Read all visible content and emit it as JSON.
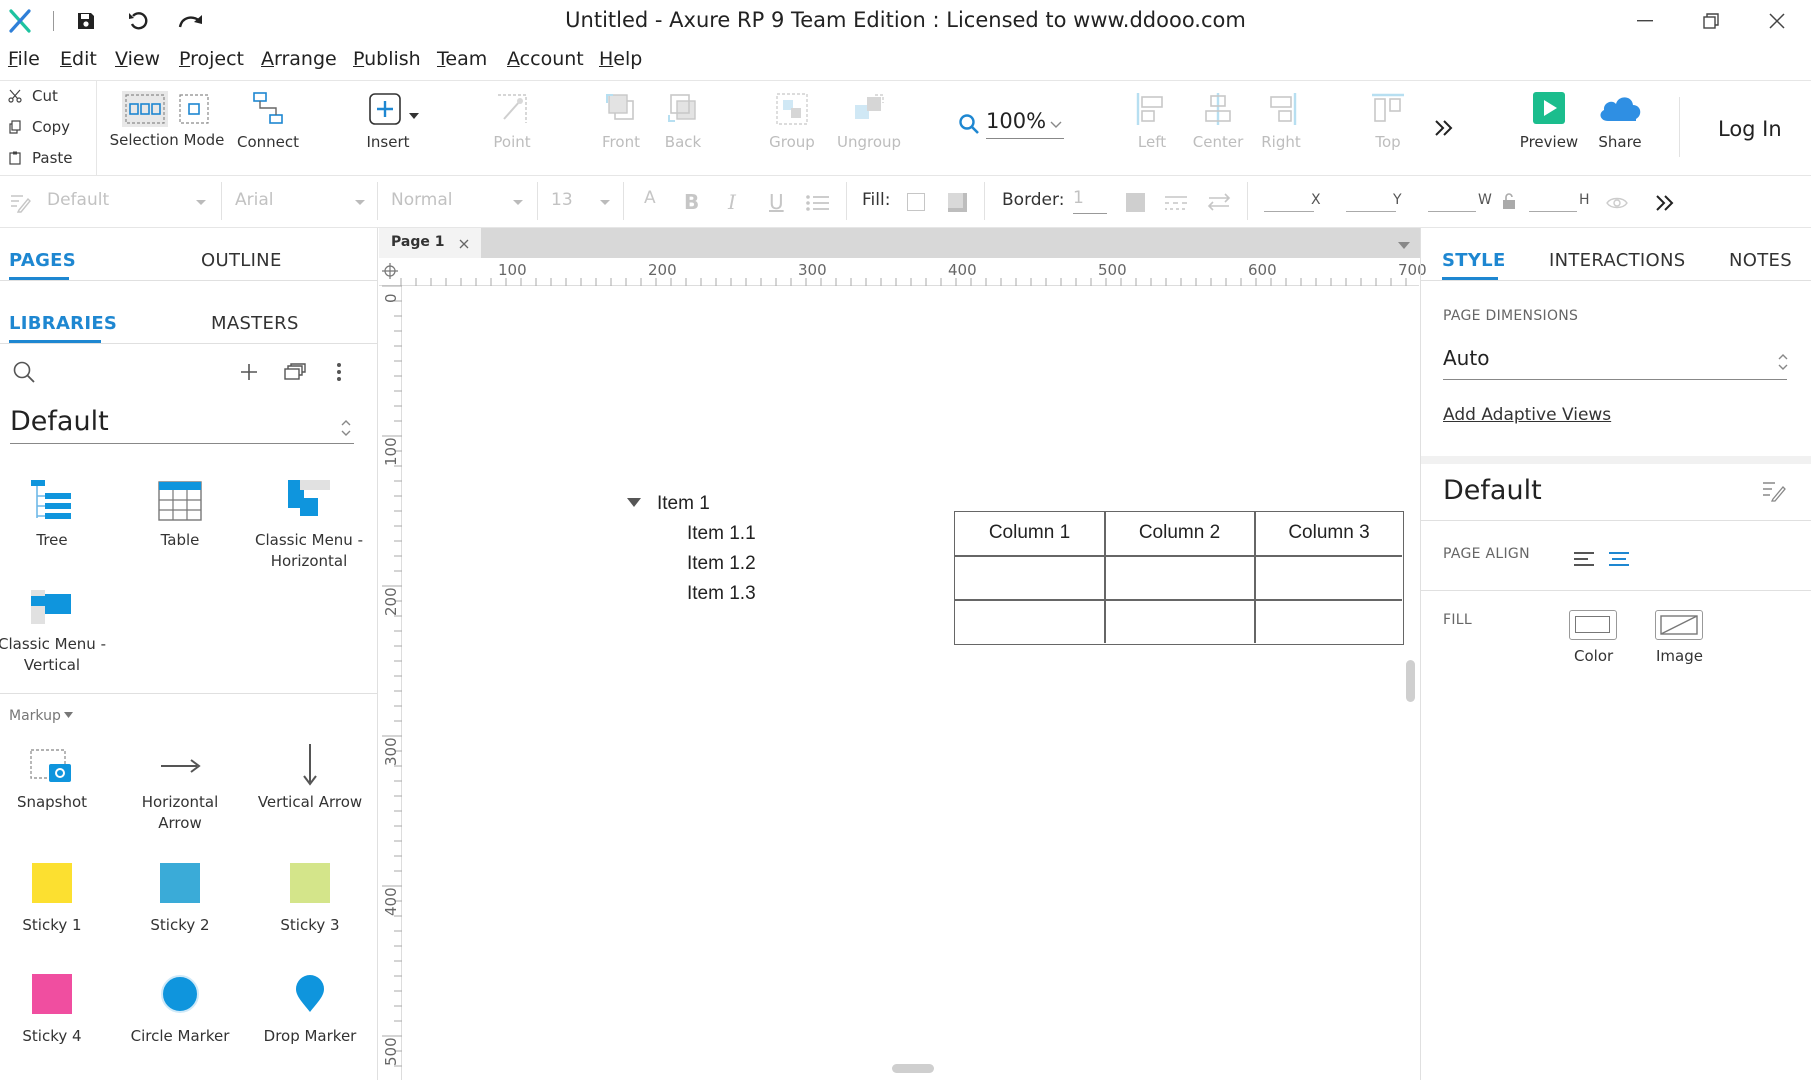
{
  "app": {
    "title": "Untitled - Axure RP 9 Team Edition : Licensed to www.ddooo.com"
  },
  "menu": [
    "File",
    "Edit",
    "View",
    "Project",
    "Arrange",
    "Publish",
    "Team",
    "Account",
    "Help"
  ],
  "menu_shortcut_letters": [
    "F",
    "E",
    "V",
    "P",
    "A",
    "P",
    "T",
    "A",
    "H"
  ],
  "clipboard": {
    "cut": "Cut",
    "copy": "Copy",
    "paste": "Paste"
  },
  "toolbar": {
    "selection_mode": "Selection Mode",
    "connect": "Connect",
    "insert": "Insert",
    "point": "Point",
    "front": "Front",
    "back": "Back",
    "group": "Group",
    "ungroup": "Ungroup",
    "zoom": "100%",
    "left": "Left",
    "center": "Center",
    "right": "Right",
    "top": "Top",
    "preview": "Preview",
    "share": "Share",
    "login": "Log In"
  },
  "format": {
    "style": "Default",
    "font": "Arial",
    "weight": "Normal",
    "size": "13",
    "fill_label": "Fill:",
    "border_label": "Border:",
    "border_value": "1",
    "x_label": "X",
    "y_label": "Y",
    "w_label": "W",
    "h_label": "H"
  },
  "left_panel": {
    "tabs": {
      "pages": "PAGES",
      "outline": "OUTLINE"
    },
    "subtabs": {
      "libraries": "LIBRARIES",
      "masters": "MASTERS"
    },
    "library": "Default",
    "widgets_top": [
      {
        "label": "Tree",
        "icon": "tree-icon"
      },
      {
        "label": "Table",
        "icon": "table-icon"
      },
      {
        "label": "Classic Menu - Horizontal",
        "icon": "classic-menu-horizontal-icon"
      },
      {
        "label": "Classic Menu - Vertical",
        "icon": "classic-menu-vertical-icon"
      }
    ],
    "markup_label": "Markup",
    "markup_widgets": [
      {
        "label": "Snapshot",
        "icon": "snapshot-icon"
      },
      {
        "label": "Horizontal Arrow",
        "icon": "horizontal-arrow-icon"
      },
      {
        "label": "Vertical Arrow",
        "icon": "vertical-arrow-icon"
      },
      {
        "label": "Sticky 1",
        "icon": "sticky-1-icon",
        "color": "#fce030"
      },
      {
        "label": "Sticky 2",
        "icon": "sticky-2-icon",
        "color": "#3aabd8"
      },
      {
        "label": "Sticky 3",
        "icon": "sticky-3-icon",
        "color": "#d4e58a"
      },
      {
        "label": "Sticky 4",
        "icon": "sticky-4-icon",
        "color": "#f04ea0"
      },
      {
        "label": "Circle Marker",
        "icon": "circle-marker-icon",
        "color": "#0f95dd"
      },
      {
        "label": "Drop Marker",
        "icon": "drop-marker-icon",
        "color": "#0f95dd"
      }
    ]
  },
  "canvas": {
    "page_tab": "Page 1",
    "hruler": [
      "100",
      "200",
      "300",
      "400",
      "500",
      "600",
      "700"
    ],
    "vruler": [
      "0",
      "100",
      "200",
      "300",
      "400",
      "500"
    ],
    "tree": {
      "root": "Item 1",
      "children": [
        "Item 1.1",
        "Item 1.2",
        "Item 1.3"
      ]
    },
    "table": {
      "headers": [
        "Column 1",
        "Column 2",
        "Column 3"
      ]
    }
  },
  "right_panel": {
    "tabs": {
      "style": "STYLE",
      "interactions": "INTERACTIONS",
      "notes": "NOTES"
    },
    "page_dimensions_label": "PAGE DIMENSIONS",
    "page_dimensions_value": "Auto",
    "adaptive_link": "Add Adaptive Views",
    "style_name": "Default",
    "page_align_label": "PAGE ALIGN",
    "fill_label": "FILL",
    "fill_color": "Color",
    "fill_image": "Image"
  },
  "colors": {
    "accent": "#1e87d1",
    "preview": "#1bbd8d",
    "share": "#2f8fe3"
  }
}
